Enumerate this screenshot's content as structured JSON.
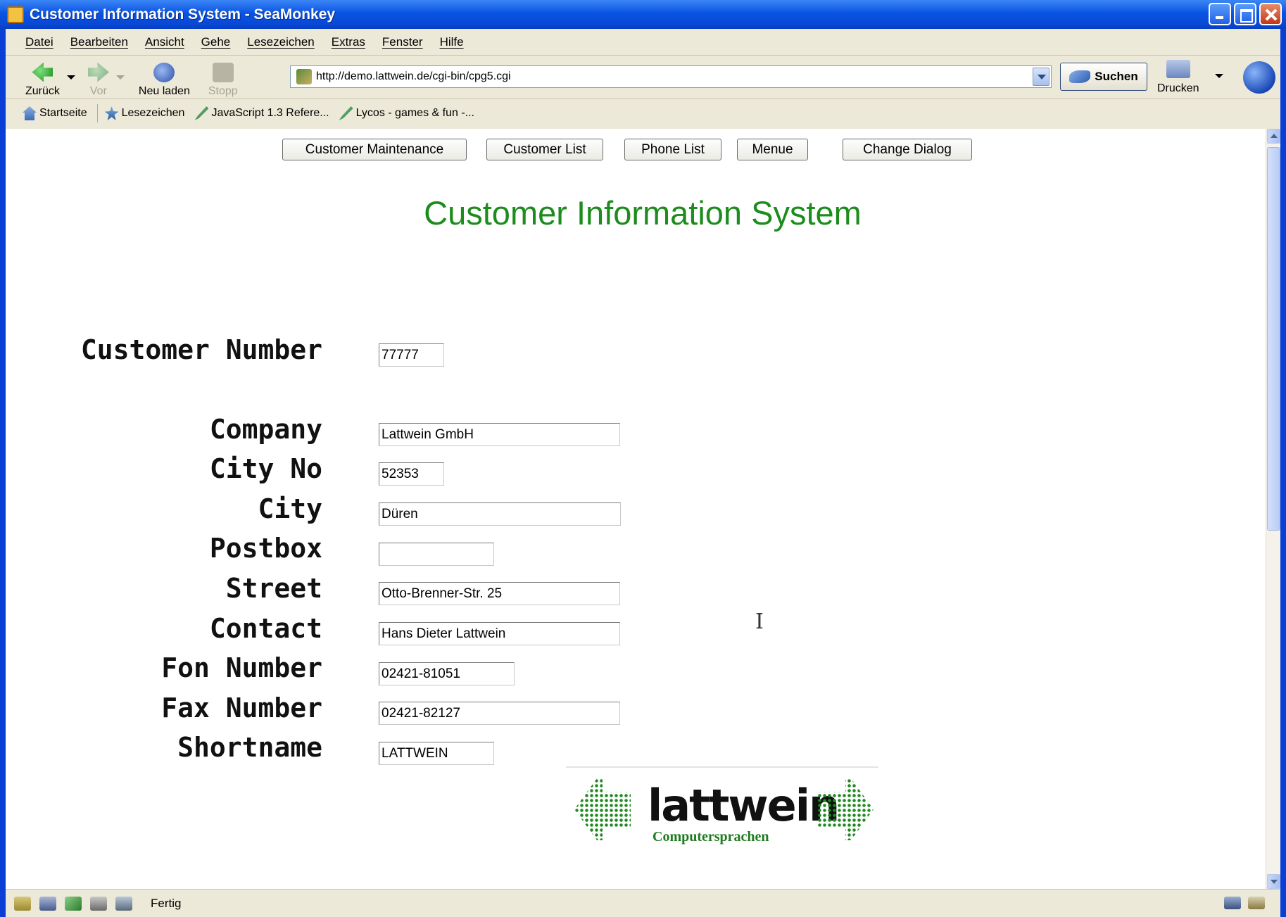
{
  "window": {
    "title": "Customer Information System - SeaMonkey"
  },
  "menu": [
    "Datei",
    "Bearbeiten",
    "Ansicht",
    "Gehe",
    "Lesezeichen",
    "Extras",
    "Fenster",
    "Hilfe"
  ],
  "toolbar": {
    "back": "Zurück",
    "forward": "Vor",
    "reload": "Neu laden",
    "stop": "Stopp",
    "url": "http://demo.lattwein.de/cgi-bin/cpg5.cgi",
    "search": "Suchen",
    "print": "Drucken"
  },
  "bookmarks": [
    {
      "label": "Startseite",
      "icon": "home-icon"
    },
    {
      "label": "Lesezeichen",
      "icon": "bookmarks-icon"
    },
    {
      "label": "JavaScript 1.3 Refere...",
      "icon": "bookmark-link-icon"
    },
    {
      "label": "Lycos - games & fun -...",
      "icon": "bookmark-link-icon"
    }
  ],
  "page": {
    "buttons": [
      "Customer Maintenance",
      "Customer List",
      "Phone List",
      "Menue",
      "Change Dialog"
    ],
    "heading": "Customer Information System",
    "fields": [
      {
        "label": "Customer Number",
        "value": "77777"
      },
      {
        "label": "Company",
        "value": "Lattwein GmbH"
      },
      {
        "label": "City No",
        "value": "52353"
      },
      {
        "label": "City",
        "value": "Düren"
      },
      {
        "label": "Postbox",
        "value": ""
      },
      {
        "label": "Street",
        "value": "Otto-Brenner-Str. 25"
      },
      {
        "label": "Contact",
        "value": "Hans Dieter Lattwein"
      },
      {
        "label": "Fon Number",
        "value": "02421-81051"
      },
      {
        "label": "Fax Number",
        "value": "02421-82127"
      },
      {
        "label": "Shortname",
        "value": "LATTWEIN"
      }
    ],
    "logo": {
      "wordmark": "lattwein",
      "tagline": "Computersprachen",
      "color": "#1f8a1f"
    }
  },
  "statusbar": {
    "text": "Fertig"
  },
  "colors": {
    "titlebar": "#0a54e3",
    "chrome": "#ece9d8",
    "heading": "#1c8c1c"
  }
}
